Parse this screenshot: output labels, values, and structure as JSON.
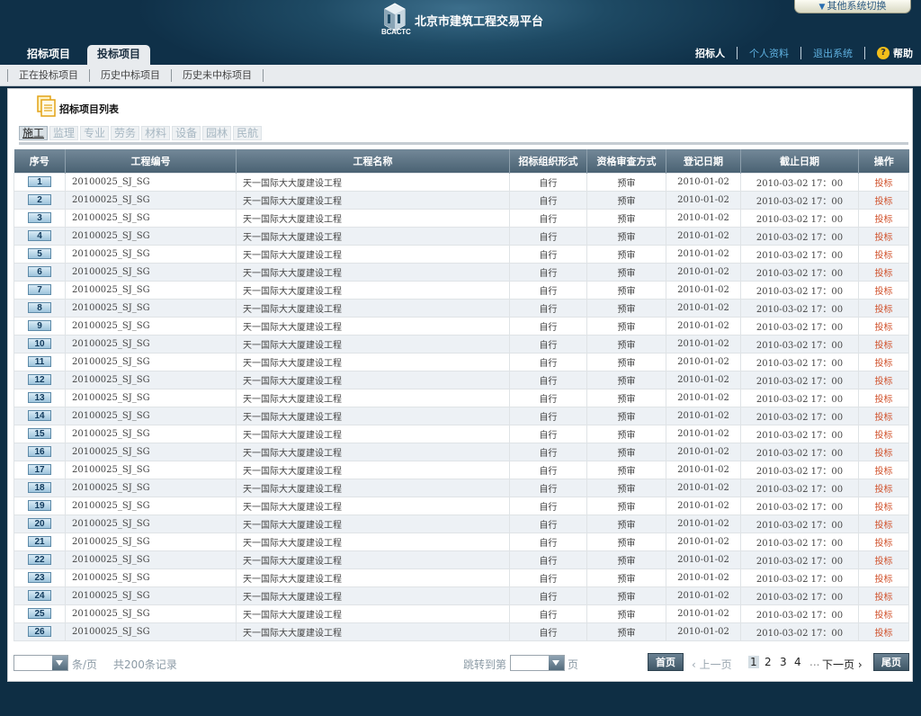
{
  "header": {
    "logo_text": "BCACTC",
    "title": "北京市建筑工程交易平台",
    "switch_label": "其他系统切换",
    "main_tabs": [
      {
        "label": "招标项目",
        "active": false
      },
      {
        "label": "投标项目",
        "active": true
      }
    ],
    "user_nav": {
      "role": "招标人",
      "profile": "个人资料",
      "logout": "退出系统",
      "help": "帮助"
    }
  },
  "subnav": [
    "正在投标项目",
    "历史中标项目",
    "历史未中标项目"
  ],
  "panel": {
    "title": "招标项目列表",
    "categories": [
      "施工",
      "监理",
      "专业",
      "劳务",
      "材料",
      "设备",
      "园林",
      "民航"
    ],
    "active_category": "施工"
  },
  "table": {
    "columns": [
      "序号",
      "工程编号",
      "工程名称",
      "招标组织形式",
      "资格审查方式",
      "登记日期",
      "截止日期",
      "操作"
    ],
    "rows": [
      [
        "1",
        "20100025_SJ_SG",
        "天一国际大大厦建设工程",
        "自行",
        "预审",
        "2010-01-02",
        "2010-03-02 17：00",
        "投标"
      ],
      [
        "2",
        "20100025_SJ_SG",
        "天一国际大大厦建设工程",
        "自行",
        "预审",
        "2010-01-02",
        "2010-03-02 17：00",
        "投标"
      ],
      [
        "3",
        "20100025_SJ_SG",
        "天一国际大大厦建设工程",
        "自行",
        "预审",
        "2010-01-02",
        "2010-03-02 17：00",
        "投标"
      ],
      [
        "4",
        "20100025_SJ_SG",
        "天一国际大大厦建设工程",
        "自行",
        "预审",
        "2010-01-02",
        "2010-03-02 17：00",
        "投标"
      ],
      [
        "5",
        "20100025_SJ_SG",
        "天一国际大大厦建设工程",
        "自行",
        "预审",
        "2010-01-02",
        "2010-03-02 17：00",
        "投标"
      ],
      [
        "6",
        "20100025_SJ_SG",
        "天一国际大大厦建设工程",
        "自行",
        "预审",
        "2010-01-02",
        "2010-03-02 17：00",
        "投标"
      ],
      [
        "7",
        "20100025_SJ_SG",
        "天一国际大大厦建设工程",
        "自行",
        "预审",
        "2010-01-02",
        "2010-03-02 17：00",
        "投标"
      ],
      [
        "8",
        "20100025_SJ_SG",
        "天一国际大大厦建设工程",
        "自行",
        "预审",
        "2010-01-02",
        "2010-03-02 17：00",
        "投标"
      ],
      [
        "9",
        "20100025_SJ_SG",
        "天一国际大大厦建设工程",
        "自行",
        "预审",
        "2010-01-02",
        "2010-03-02 17：00",
        "投标"
      ],
      [
        "10",
        "20100025_SJ_SG",
        "天一国际大大厦建设工程",
        "自行",
        "预审",
        "2010-01-02",
        "2010-03-02 17：00",
        "投标"
      ],
      [
        "11",
        "20100025_SJ_SG",
        "天一国际大大厦建设工程",
        "自行",
        "预审",
        "2010-01-02",
        "2010-03-02 17：00",
        "投标"
      ],
      [
        "12",
        "20100025_SJ_SG",
        "天一国际大大厦建设工程",
        "自行",
        "预审",
        "2010-01-02",
        "2010-03-02 17：00",
        "投标"
      ],
      [
        "13",
        "20100025_SJ_SG",
        "天一国际大大厦建设工程",
        "自行",
        "预审",
        "2010-01-02",
        "2010-03-02 17：00",
        "投标"
      ],
      [
        "14",
        "20100025_SJ_SG",
        "天一国际大大厦建设工程",
        "自行",
        "预审",
        "2010-01-02",
        "2010-03-02 17：00",
        "投标"
      ],
      [
        "15",
        "20100025_SJ_SG",
        "天一国际大大厦建设工程",
        "自行",
        "预审",
        "2010-01-02",
        "2010-03-02 17：00",
        "投标"
      ],
      [
        "16",
        "20100025_SJ_SG",
        "天一国际大大厦建设工程",
        "自行",
        "预审",
        "2010-01-02",
        "2010-03-02 17：00",
        "投标"
      ],
      [
        "17",
        "20100025_SJ_SG",
        "天一国际大大厦建设工程",
        "自行",
        "预审",
        "2010-01-02",
        "2010-03-02 17：00",
        "投标"
      ],
      [
        "18",
        "20100025_SJ_SG",
        "天一国际大大厦建设工程",
        "自行",
        "预审",
        "2010-01-02",
        "2010-03-02 17：00",
        "投标"
      ],
      [
        "19",
        "20100025_SJ_SG",
        "天一国际大大厦建设工程",
        "自行",
        "预审",
        "2010-01-02",
        "2010-03-02 17：00",
        "投标"
      ],
      [
        "20",
        "20100025_SJ_SG",
        "天一国际大大厦建设工程",
        "自行",
        "预审",
        "2010-01-02",
        "2010-03-02 17：00",
        "投标"
      ],
      [
        "21",
        "20100025_SJ_SG",
        "天一国际大大厦建设工程",
        "自行",
        "预审",
        "2010-01-02",
        "2010-03-02 17：00",
        "投标"
      ],
      [
        "22",
        "20100025_SJ_SG",
        "天一国际大大厦建设工程",
        "自行",
        "预审",
        "2010-01-02",
        "2010-03-02 17：00",
        "投标"
      ],
      [
        "23",
        "20100025_SJ_SG",
        "天一国际大大厦建设工程",
        "自行",
        "预审",
        "2010-01-02",
        "2010-03-02 17：00",
        "投标"
      ],
      [
        "24",
        "20100025_SJ_SG",
        "天一国际大大厦建设工程",
        "自行",
        "预审",
        "2010-01-02",
        "2010-03-02 17：00",
        "投标"
      ],
      [
        "25",
        "20100025_SJ_SG",
        "天一国际大大厦建设工程",
        "自行",
        "预审",
        "2010-01-02",
        "2010-03-02 17：00",
        "投标"
      ],
      [
        "26",
        "20100025_SJ_SG",
        "天一国际大大厦建设工程",
        "自行",
        "预审",
        "2010-01-02",
        "2010-03-02 17：00",
        "投标"
      ]
    ]
  },
  "pager": {
    "per_page_suffix": "条/页",
    "total": "共200条记录",
    "jump_label": "跳转到第",
    "page_suffix": "页",
    "first": "首页",
    "prev": "上一页",
    "pages": [
      "1",
      "2",
      "3",
      "4"
    ],
    "current_page": "1",
    "ellipsis": "...",
    "next": "下一页",
    "last": "尾页"
  },
  "colors": {
    "header_bg": "#1e4a64",
    "op_link": "#d0502a",
    "link_blue": "#5fb1e0"
  }
}
